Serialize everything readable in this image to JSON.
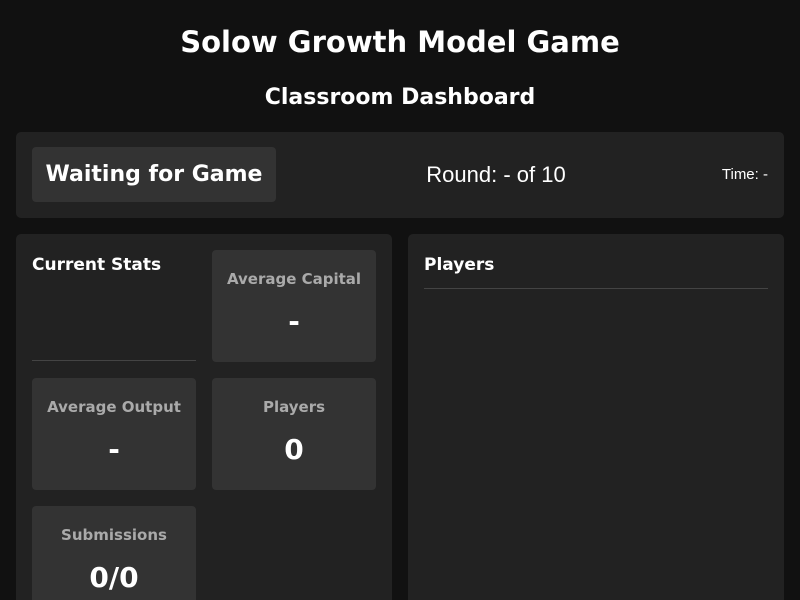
{
  "header": {
    "title": "Solow Growth Model Game",
    "subtitle": "Classroom Dashboard"
  },
  "status_bar": {
    "game_state": "Waiting for Game",
    "round_label": "Round:",
    "round_current": "-",
    "round_of": "of",
    "round_total": "10",
    "time_label": "Time:",
    "time_value": "-"
  },
  "stats_panel": {
    "heading": "Current Stats",
    "cards": [
      {
        "label": "Average Capital",
        "value": "-"
      },
      {
        "label": "Average Output",
        "value": "-"
      },
      {
        "label": "Players",
        "value": "0"
      },
      {
        "label": "Submissions",
        "value": "0/0"
      }
    ]
  },
  "players_panel": {
    "heading": "Players",
    "items": []
  }
}
